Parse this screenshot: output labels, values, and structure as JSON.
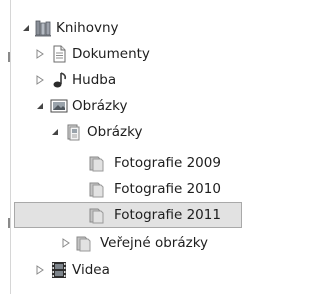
{
  "tree": {
    "items": [
      {
        "label": "Knihovny",
        "icon": "libraries-icon",
        "expander": "expanded"
      },
      {
        "label": "Dokumenty",
        "icon": "documents-library-icon",
        "expander": "collapsed"
      },
      {
        "label": "Hudba",
        "icon": "music-library-icon",
        "expander": "collapsed"
      },
      {
        "label": "Obrázky",
        "icon": "pictures-library-icon",
        "expander": "expanded"
      },
      {
        "label": "Obrázky",
        "icon": "pictures-folder-icon",
        "expander": "expanded"
      },
      {
        "label": "Fotografie 2009",
        "icon": "folder-icon",
        "expander": "none"
      },
      {
        "label": "Fotografie 2010",
        "icon": "folder-icon",
        "expander": "none"
      },
      {
        "label": "Fotografie 2011",
        "icon": "folder-icon",
        "expander": "none",
        "selected": true
      },
      {
        "label": "Veřejné obrázky",
        "icon": "public-pictures-folder-icon",
        "expander": "collapsed"
      },
      {
        "label": "Videa",
        "icon": "videos-library-icon",
        "expander": "collapsed"
      }
    ]
  }
}
